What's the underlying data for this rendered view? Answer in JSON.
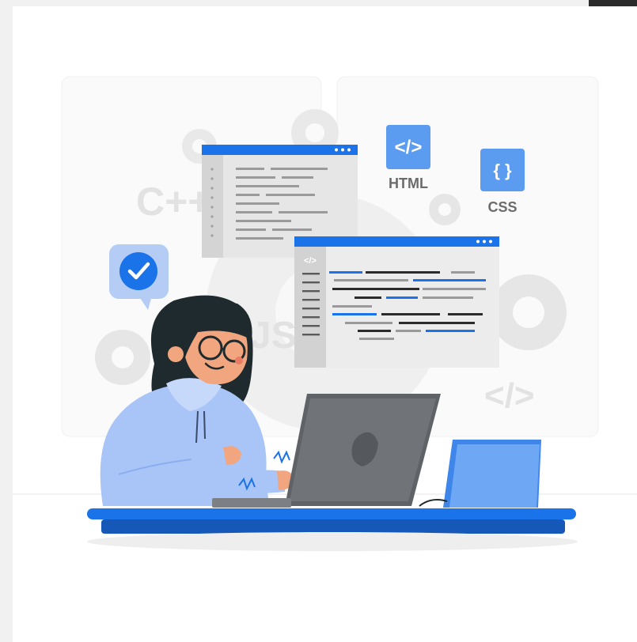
{
  "illustration": {
    "html_badge_glyph": "</>",
    "html_label": "HTML",
    "css_badge_glyph": "{ }",
    "css_label": "CSS",
    "cpp_text": "C++",
    "js_text": "JS",
    "tag_text": "</>",
    "code_window_glyph": "</>",
    "check_icon": "check-icon",
    "laptop_logo_icon": "apple-logo-icon"
  },
  "colors": {
    "accent": "#1a73e8",
    "badge_blue": "#5b9bf0",
    "hoodie": "#a9c5f7",
    "hair": "#1f2a2e",
    "desk": "#1f6fe0",
    "laptop": "#5f6368",
    "tablet": "#5c9ef2"
  }
}
